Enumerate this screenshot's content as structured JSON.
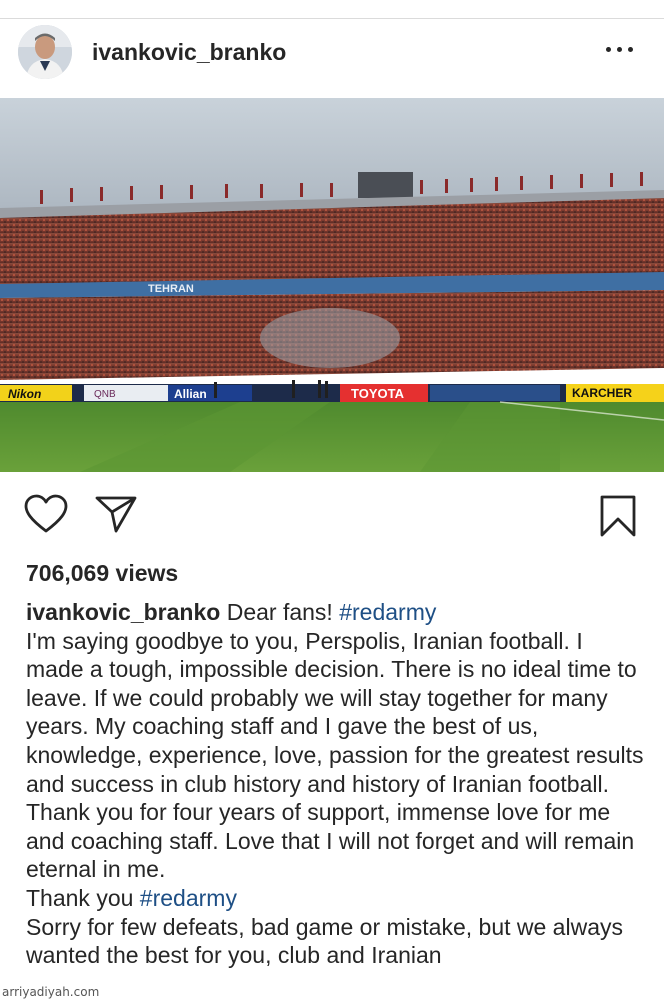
{
  "post": {
    "username": "ivankovic_branko",
    "views": "706,069 views",
    "media_text": {
      "stadium_banner": "TEHRAN",
      "ad_nikon": "Nikon",
      "ad_qnb": "QNB",
      "ad_allianz": "Allian",
      "ad_toyota": "TOYOTA",
      "ad_karcher": "KARCHER"
    },
    "caption": {
      "username": "ivankovic_branko",
      "intro": "Dear fans!",
      "hashtag1": "#redarmy",
      "body": "I'm saying goodbye to you, Perspolis, Iranian football. I made a tough, impossible decision. There is no ideal time to leave. If we could probably we will stay together for many years. My coaching staff and I gave the best of us, knowledge, experience, love, passion for the greatest results and success in club history and history of Iranian football. Thank you for four years of support, immense love for me and coaching staff. Love that I will not forget and will remain eternal in me.",
      "thanks": "Thank you",
      "hashtag2": "#redarmy",
      "sorry": "Sorry for few defeats, bad game or mistake, but we always wanted the best for you, club and Iranian"
    }
  },
  "watermark": "arriyadiyah.com",
  "icons": [
    "more-options-icon",
    "heart-icon",
    "share-icon",
    "bookmark-icon"
  ],
  "colors": {
    "hashtag": "#1e4f85",
    "text": "#262626"
  }
}
